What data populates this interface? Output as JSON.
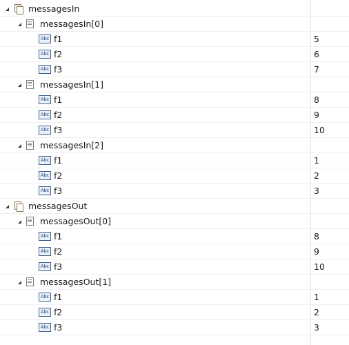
{
  "tree": [
    {
      "label": "messagesIn",
      "type": "collection",
      "children": [
        {
          "label": "messagesIn[0]",
          "type": "document",
          "children": [
            {
              "label": "f1",
              "value": "5"
            },
            {
              "label": "f2",
              "value": "6"
            },
            {
              "label": "f3",
              "value": "7"
            }
          ]
        },
        {
          "label": "messagesIn[1]",
          "type": "document",
          "children": [
            {
              "label": "f1",
              "value": "8"
            },
            {
              "label": "f2",
              "value": "9"
            },
            {
              "label": "f3",
              "value": "10"
            }
          ]
        },
        {
          "label": "messagesIn[2]",
          "type": "document",
          "children": [
            {
              "label": "f1",
              "value": "1"
            },
            {
              "label": "f2",
              "value": "2"
            },
            {
              "label": "f3",
              "value": "3"
            }
          ]
        }
      ]
    },
    {
      "label": "messagesOut",
      "type": "collection",
      "children": [
        {
          "label": "messagesOut[0]",
          "type": "document",
          "children": [
            {
              "label": "f1",
              "value": "8"
            },
            {
              "label": "f2",
              "value": "9"
            },
            {
              "label": "f3",
              "value": "10"
            }
          ]
        },
        {
          "label": "messagesOut[1]",
          "type": "document",
          "children": [
            {
              "label": "f1",
              "value": "1"
            },
            {
              "label": "f2",
              "value": "2"
            },
            {
              "label": "f3",
              "value": "3"
            }
          ]
        }
      ]
    }
  ],
  "icons": {
    "collection": "collection-icon",
    "document": "document-icon",
    "field": "string-field-icon",
    "field_badge_text": "Abc",
    "expanded": "expanded-triangle-icon"
  }
}
